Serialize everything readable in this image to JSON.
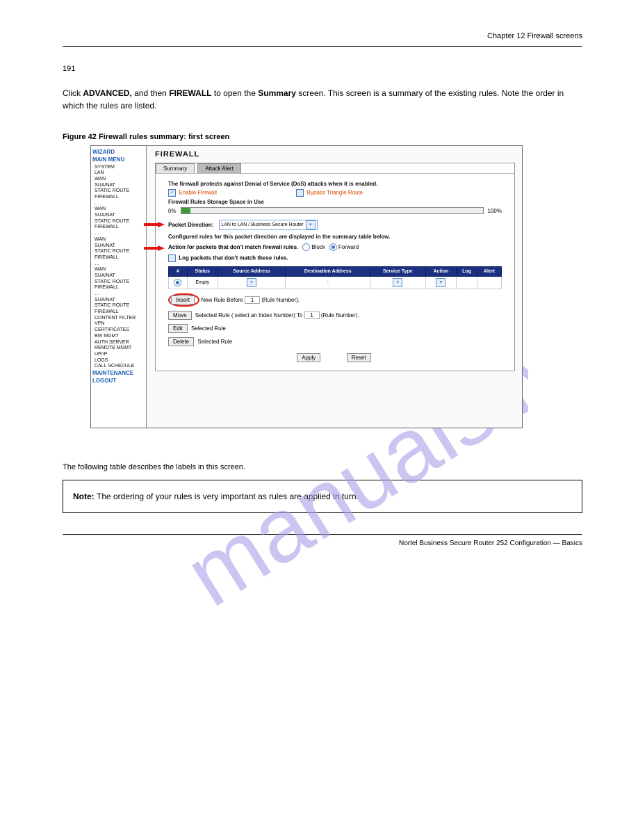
{
  "header_right": "Chapter 12 Firewall screens",
  "section_line": "191",
  "intro": {
    "part1": "Click ",
    "bold1": "ADVANCED,",
    "part2": " and then ",
    "bold2": "FIREWALL",
    "part3": " to open the ",
    "bold3": "Summary",
    "part4": " screen. This screen is a summary of the existing rules. Note the order in which the rules are listed."
  },
  "figure_top": "Figure 42   Firewall rules summary: first screen",
  "sidebar": {
    "wizard": "WIZARD",
    "main_menu": "MAIN MENU",
    "items": [
      "SYSTEM",
      "LAN",
      "WAN",
      "SUA/NAT",
      "STATIC ROUTE",
      "FIREWALL",
      "…",
      "WAN",
      "SUA/NAT",
      "STATIC ROUTE",
      "FIREWALL",
      "…",
      "WAN",
      "SUA/NAT",
      "STATIC ROUTE",
      "FIREWALL",
      "…",
      "WAN",
      "SUA/NAT",
      "STATIC ROUTE",
      "FIREWALL",
      "…",
      "SUA/NAT",
      "STATIC ROUTE",
      "FIREWALL",
      "CONTENT FILTER",
      "VPN",
      "CERTIFICATES",
      "BW MGMT",
      "AUTH SERVER",
      "REMOTE MGMT",
      "UPnP",
      "LOGS",
      "CALL SCHEDULE"
    ],
    "maintenance": "MAINTENANCE",
    "logout": "LOGOUT"
  },
  "panel": {
    "title": "FIREWALL",
    "tabs": {
      "summary": "Summary",
      "attack": "Attack Alert"
    },
    "dos_text": "The firewall protects against Denial of Service (DoS) attacks when it is enabled.",
    "enable_fw": "Enable Firewall",
    "bypass": "Bypass Triangle Route",
    "storage": "Firewall Rules Storage Space in Use",
    "pct0": "0%",
    "pct100": "100%",
    "pkt_dir": "Packet Direction:",
    "pkt_dir_value": "LAN to LAN / Business Secure Router",
    "configured": "Configured rules for this packet direction are displayed in the summary table below.",
    "action_text": "Action for packets that don't match firewall rules.",
    "block": "Block",
    "forward": "Forward",
    "log_text": "Log packets that don't match these rules.",
    "table": {
      "h1": "#",
      "h2": "Status",
      "h3": "Source Address",
      "h4": "Destination Address",
      "h5": "Service Type",
      "h6": "Action",
      "h7": "Log",
      "h8": "Alert",
      "empty": "Empty",
      "dash": "-"
    },
    "buttons": {
      "insert": "Insert",
      "insert_text1": "New Rule Before",
      "insert_num": "1",
      "insert_text2": "(Rule Number).",
      "move": "Move",
      "move_text1": "Selected Rule ( select an Index Number) To",
      "move_num": "1",
      "move_text2": "(Rule Number).",
      "edit": "Edit",
      "edit_text": "Selected Rule",
      "delete": "Delete",
      "delete_text": "Selected Rule",
      "apply": "Apply",
      "reset": "Reset"
    }
  },
  "figure_bottom_text": "The following table describes the labels in this screen.",
  "note_text": "The ordering of your rules is very important as rules are applied in turn.",
  "footer": {
    "left": "Nortel Business Secure Router 252 Configuration — Basics",
    "right": ""
  }
}
